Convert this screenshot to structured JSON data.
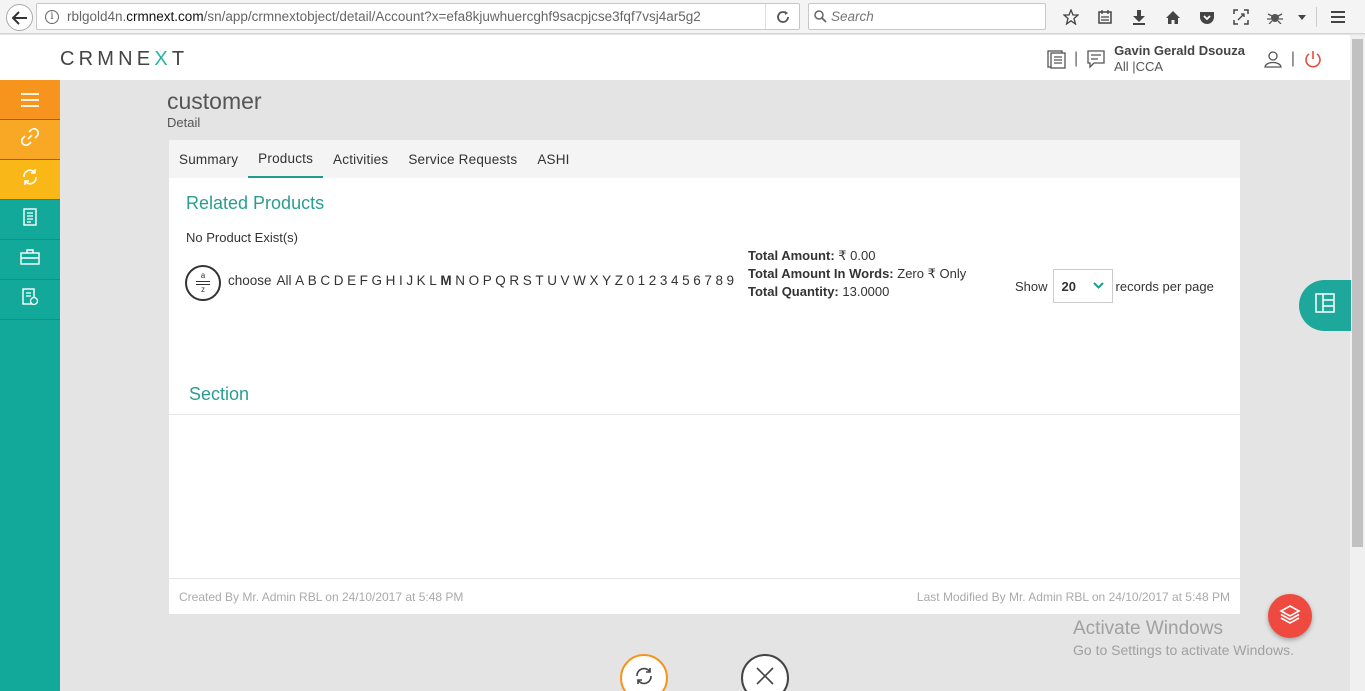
{
  "browser": {
    "url_prefix": "rblgold4n.",
    "url_domain": "crmnext.com",
    "url_path": "/sn/app/crmnextobject/detail/Account?x=efa8kjuwhuercghf9sacpjcse3fqf7vsj4ar5g2",
    "search_placeholder": "Search"
  },
  "header": {
    "logo_left": "CRMNE",
    "logo_x": "X",
    "logo_right": "T",
    "user_name": "Gavin Gerald Dsouza",
    "user_role": "All |CCA"
  },
  "page": {
    "title": "customer",
    "subtitle": "Detail"
  },
  "tabs": [
    {
      "label": "Summary"
    },
    {
      "label": "Products"
    },
    {
      "label": "Activities"
    },
    {
      "label": "Service Requests"
    },
    {
      "label": "ASHI"
    }
  ],
  "related": {
    "title": "Related Products",
    "empty_text": "No Product Exist(s)",
    "choose_label": "choose",
    "letters": [
      "All",
      "A",
      "B",
      "C",
      "D",
      "E",
      "F",
      "G",
      "H",
      "I",
      "J",
      "K",
      "L",
      "M",
      "N",
      "O",
      "P",
      "Q",
      "R",
      "S",
      "T",
      "U",
      "V",
      "W",
      "X",
      "Y",
      "Z",
      "0",
      "1",
      "2",
      "3",
      "4",
      "5",
      "6",
      "7",
      "8",
      "9"
    ],
    "bold_letter": "M",
    "total_amount_label": "Total Amount:",
    "total_amount_value": " ₹ 0.00",
    "total_words_label": "Total Amount In Words:",
    "total_words_value": " Zero ₹ Only",
    "total_qty_label": "Total Quantity:",
    "total_qty_value": " 13.0000",
    "show_label": "Show",
    "records_per_page": "20",
    "records_label": "records per page"
  },
  "section": {
    "title": "Section"
  },
  "footer": {
    "created": "Created By Mr. Admin RBL on 24/10/2017 at 5:48 PM",
    "modified": "Last Modified By Mr. Admin RBL on 24/10/2017 at 5:48 PM"
  },
  "watermark": {
    "line1": "Activate Windows",
    "line2": "Go to Settings to activate Windows."
  },
  "colors": {
    "accent": "#12a89a",
    "menu_orange": "#f7941d",
    "fab_red": "#ee4a40"
  }
}
